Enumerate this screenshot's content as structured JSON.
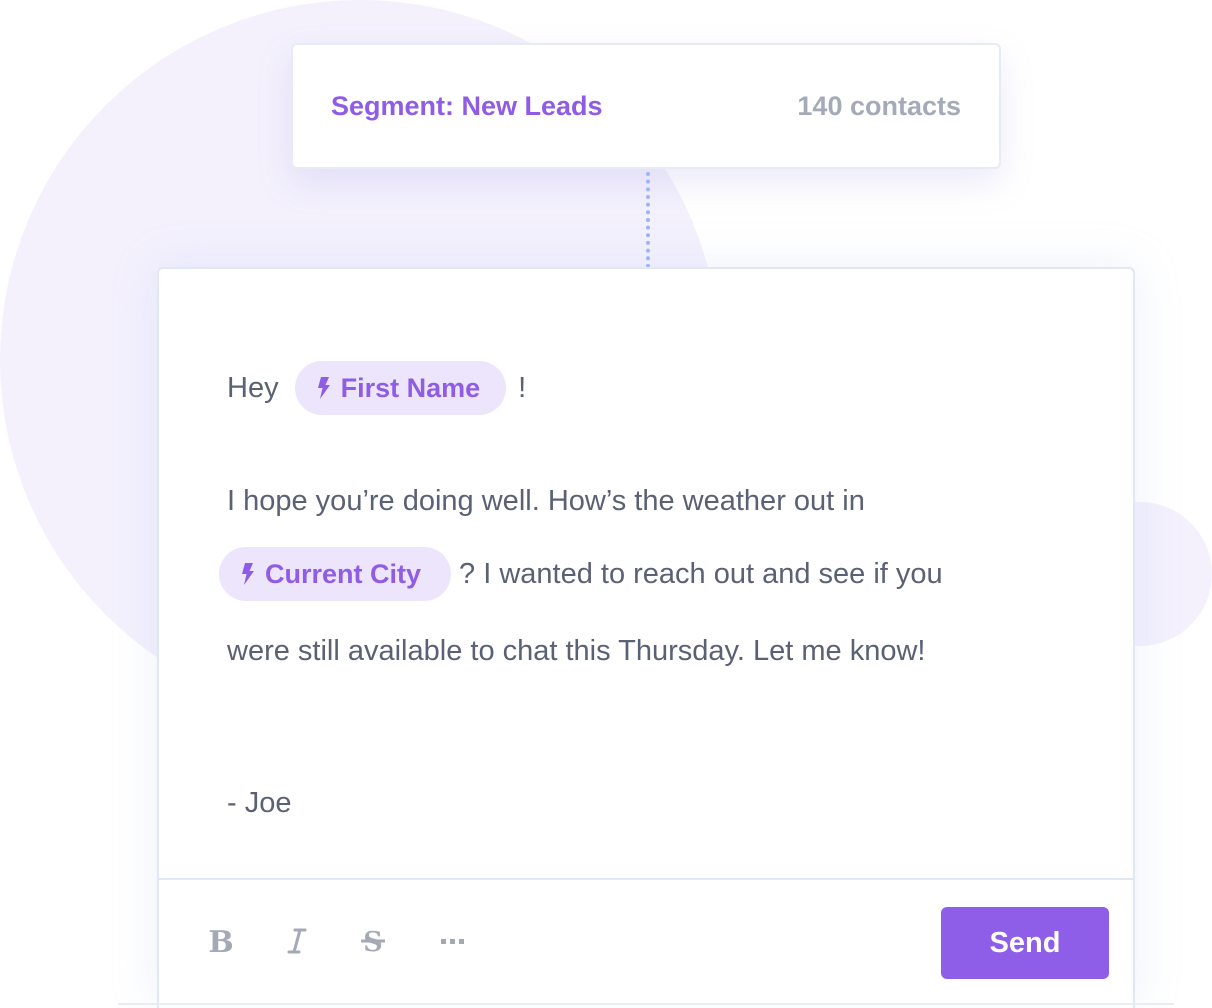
{
  "segment": {
    "label": "Segment: New Leads",
    "count": "140 contacts"
  },
  "message": {
    "greeting_prefix": "Hey",
    "greeting_suffix": "!",
    "first_name_tag": "First Name",
    "line1": "I hope you’re doing well. How’s the weather out in",
    "city_tag": "Current City",
    "line2_rest": "? I wanted to reach out and see if you",
    "line3": "were still available to chat this Thursday. Let me know!",
    "signature": "- Joe"
  },
  "toolbar": {
    "bold_icon": "bold-icon",
    "italic_icon": "italic-icon",
    "strikethrough_icon": "strikethrough-icon",
    "more_icon": "more-icon",
    "send_label": "Send"
  },
  "colors": {
    "accent": "#8f5ce6",
    "tag_background": "#ede5fb",
    "body_text": "#5b6175",
    "muted_text": "#a4aab8",
    "background_shape": "#f4f1fd"
  }
}
